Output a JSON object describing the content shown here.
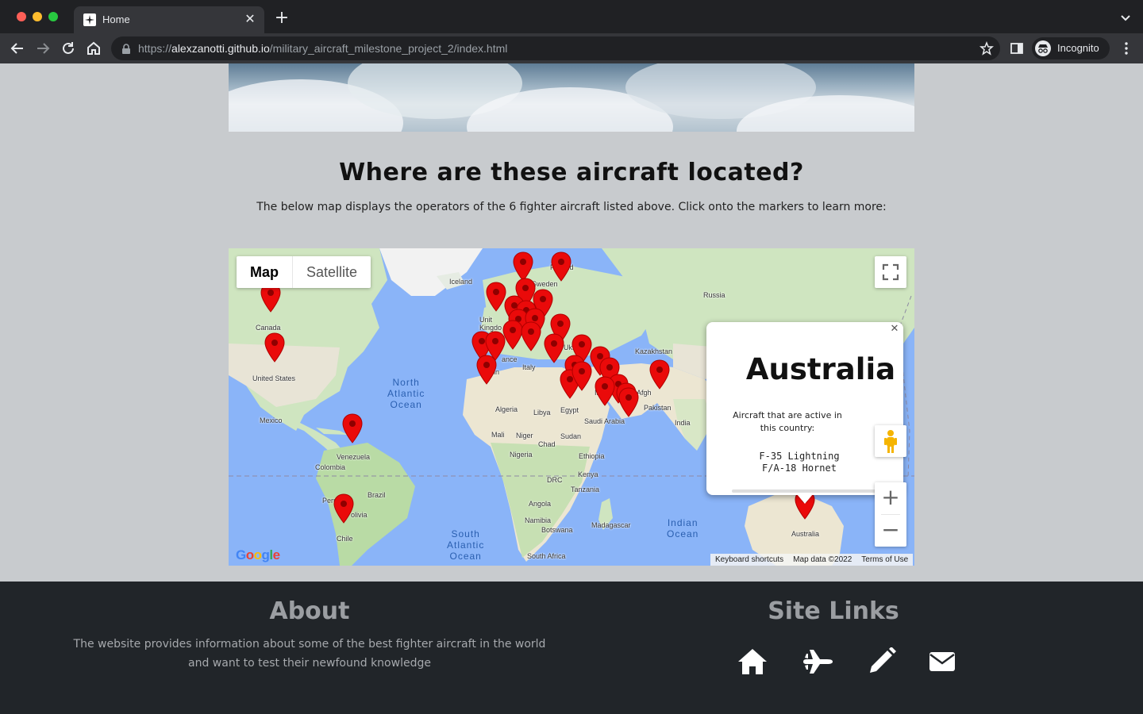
{
  "browser": {
    "tab_title": "Home",
    "tab_close": "✕",
    "new_tab": "+",
    "url_scheme": "https://",
    "url_host": "alexzanotti.github.io",
    "url_path": "/military_aircraft_milestone_project_2/index.html",
    "profile_label": "Incognito"
  },
  "section": {
    "title": "Where are these aircraft located?",
    "subtitle": "The below map displays the operators of the 6 fighter aircraft listed above. Click onto the markers to learn more:"
  },
  "map": {
    "type_map": "Map",
    "type_satellite": "Satellite",
    "zoom_in": "+",
    "zoom_out": "−",
    "attribution": {
      "shortcuts": "Keyboard shortcuts",
      "data": "Map data ©2022",
      "terms": "Terms of Use"
    },
    "google_logo": "Google",
    "labels": {
      "iceland": "Iceland",
      "finland": "Finland",
      "sweden": "Sweden",
      "norway": "No",
      "uk": "Unit Kingdo",
      "russia": "Russia",
      "canada": "Canada",
      "us": "United States",
      "mexico": "Mexico",
      "france": "ance",
      "spain": "in",
      "italy": "Italy",
      "ukraine": "Ukraine",
      "kazakhstan": "Kazakhstan",
      "algeria": "Algeria",
      "libya": "Libya",
      "egypt": "Egypt",
      "saudi": "Saudi Arabia",
      "afghanistan": "Afgh",
      "pakistan": "Pakistan",
      "india": "India",
      "mali": "Mali",
      "niger": "Niger",
      "chad": "Chad",
      "sudan": "Sudan",
      "nigeria": "Nigeria",
      "ethiopia": "Ethiopia",
      "drc": "DRC",
      "kenya": "Kenya",
      "tanzania": "Tanzania",
      "angola": "Angola",
      "namibia": "Namibia",
      "botswana": "Botswana",
      "madagascar": "Madagascar",
      "south_africa": "South Africa",
      "venezuela": "Venezuela",
      "colombia": "Colombia",
      "peru": "Peru",
      "brazil": "Brazil",
      "bolivia": "olivia",
      "chile": "Chile",
      "australia": "Australia",
      "iran": "Ira",
      "north_atlantic": "North\nAtlantic\nOcean",
      "south_atlantic": "South\nAtlantic\nOcean",
      "indian_ocean": "Indian\nOcean"
    },
    "infowindow": {
      "close": "✕",
      "country": "Australia",
      "description": "Aircraft that are active in this country:",
      "aircraft": [
        "F-35 Lightning",
        "F/A-18 Hornet"
      ]
    }
  },
  "footer": {
    "about_title": "About",
    "about_text": "The website provides information about some of the best fighter aircraft in the world and want to test their newfound knowledge",
    "links_title": "Site Links",
    "links": [
      "home-icon",
      "plane-icon",
      "pencil-icon",
      "envelope-icon"
    ]
  },
  "colors": {
    "page_bg": "#c8cbce",
    "footer_bg": "#212529",
    "marker": "#ea0a0a",
    "water": "#8ab4f8",
    "land": "#cfe5c0"
  }
}
